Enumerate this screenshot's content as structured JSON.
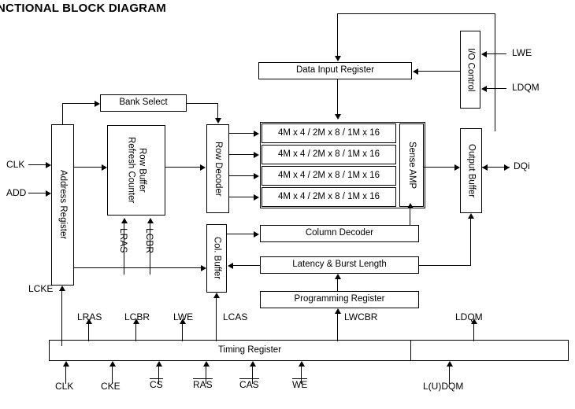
{
  "title": "NCTIONAL BLOCK DIAGRAM",
  "blocks": {
    "address_register": "Address Register",
    "bank_select": "Bank Select",
    "refresh_counter": "Refresh Counter",
    "row_buffer": "Row Buffer",
    "row_decoder": "Row Decoder",
    "sense_amp": "Sense AMP",
    "col_buffer": "Col. Buffer",
    "column_decoder": "Column Decoder",
    "latency_burst": "Latency & Burst Length",
    "programming_register": "Programming Register",
    "data_input_register": "Data Input Register",
    "io_control": "I/O Control",
    "output_buffer": "Output Buffer",
    "timing_register": "Timing Register",
    "memory_banks": [
      "4M x 4 / 2M x 8 / 1M x 16",
      "4M x 4 / 2M x 8 / 1M x 16",
      "4M x 4 / 2M x 8 / 1M x 16",
      "4M x 4 / 2M x 8 / 1M x 16"
    ]
  },
  "signals": {
    "clk_in": "CLK",
    "add_in": "ADD",
    "lcke": "LCKE",
    "lras_v": "LRAS",
    "lcbr_v": "LCBR",
    "lwe_io": "LWE",
    "ldqm_io": "LDQM",
    "dqi": "DQi",
    "lcas": "LCAS",
    "internal_row": "LRAS",
    "internal_cbr": "LCBR",
    "internal_we": "LWE",
    "lwcbr": "LWCBR",
    "ldqm_out": "LDQM",
    "clk_bottom": "CLK",
    "cke_bottom": "CKE",
    "cs_bottom": "CS",
    "ras_bottom": "RAS",
    "cas_bottom": "CAS",
    "we_bottom": "WE",
    "ludqm_bottom": "L(U)DQM"
  },
  "colors": {
    "line": "#000000",
    "background": "#ffffff",
    "text": "#000000"
  }
}
